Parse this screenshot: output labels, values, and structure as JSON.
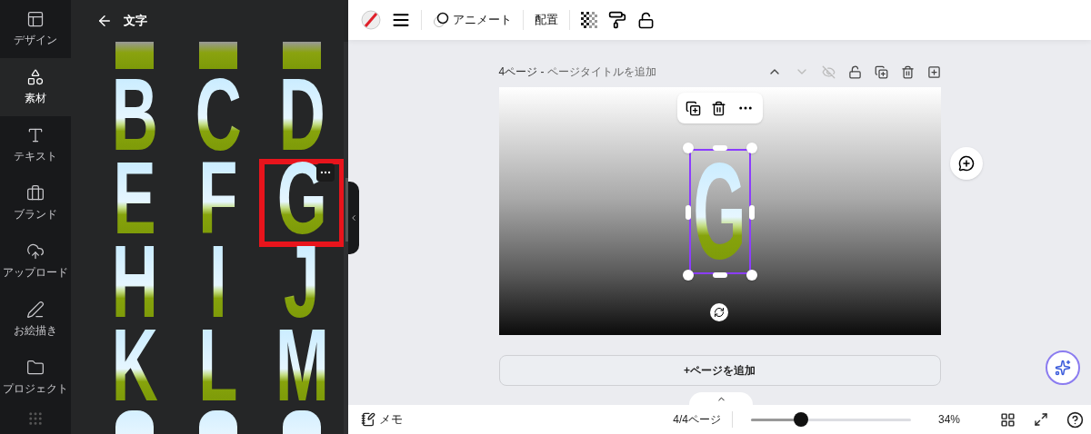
{
  "sidebar": {
    "items": [
      {
        "label": "デザイン",
        "selected": false
      },
      {
        "label": "素材",
        "selected": true
      },
      {
        "label": "テキスト",
        "selected": false
      },
      {
        "label": "ブランド",
        "selected": false
      },
      {
        "label": "アップロード",
        "selected": false
      },
      {
        "label": "お絵描き",
        "selected": false
      },
      {
        "label": "プロジェクト",
        "selected": false
      }
    ]
  },
  "panel": {
    "title": "文字",
    "letters": [
      {
        "letter": "B",
        "selected": false
      },
      {
        "letter": "C",
        "selected": false
      },
      {
        "letter": "D",
        "selected": false
      },
      {
        "letter": "E",
        "selected": false
      },
      {
        "letter": "F",
        "selected": false
      },
      {
        "letter": "G",
        "selected": true
      },
      {
        "letter": "H",
        "selected": false
      },
      {
        "letter": "I",
        "selected": false
      },
      {
        "letter": "J",
        "selected": false
      },
      {
        "letter": "K",
        "selected": false
      },
      {
        "letter": "L",
        "selected": false
      },
      {
        "letter": "M",
        "selected": false
      }
    ]
  },
  "toolbar": {
    "animate": "アニメート",
    "position": "配置"
  },
  "page": {
    "label": "4ページ",
    "separator": "-",
    "title_placeholder": "ページタイトルを追加",
    "element_letter": "G"
  },
  "add_page": "+ページを追加",
  "footer": {
    "notes": "メモ",
    "page_count": "4/4ページ",
    "zoom": {
      "level": 0.31,
      "reading": "34%"
    }
  }
}
